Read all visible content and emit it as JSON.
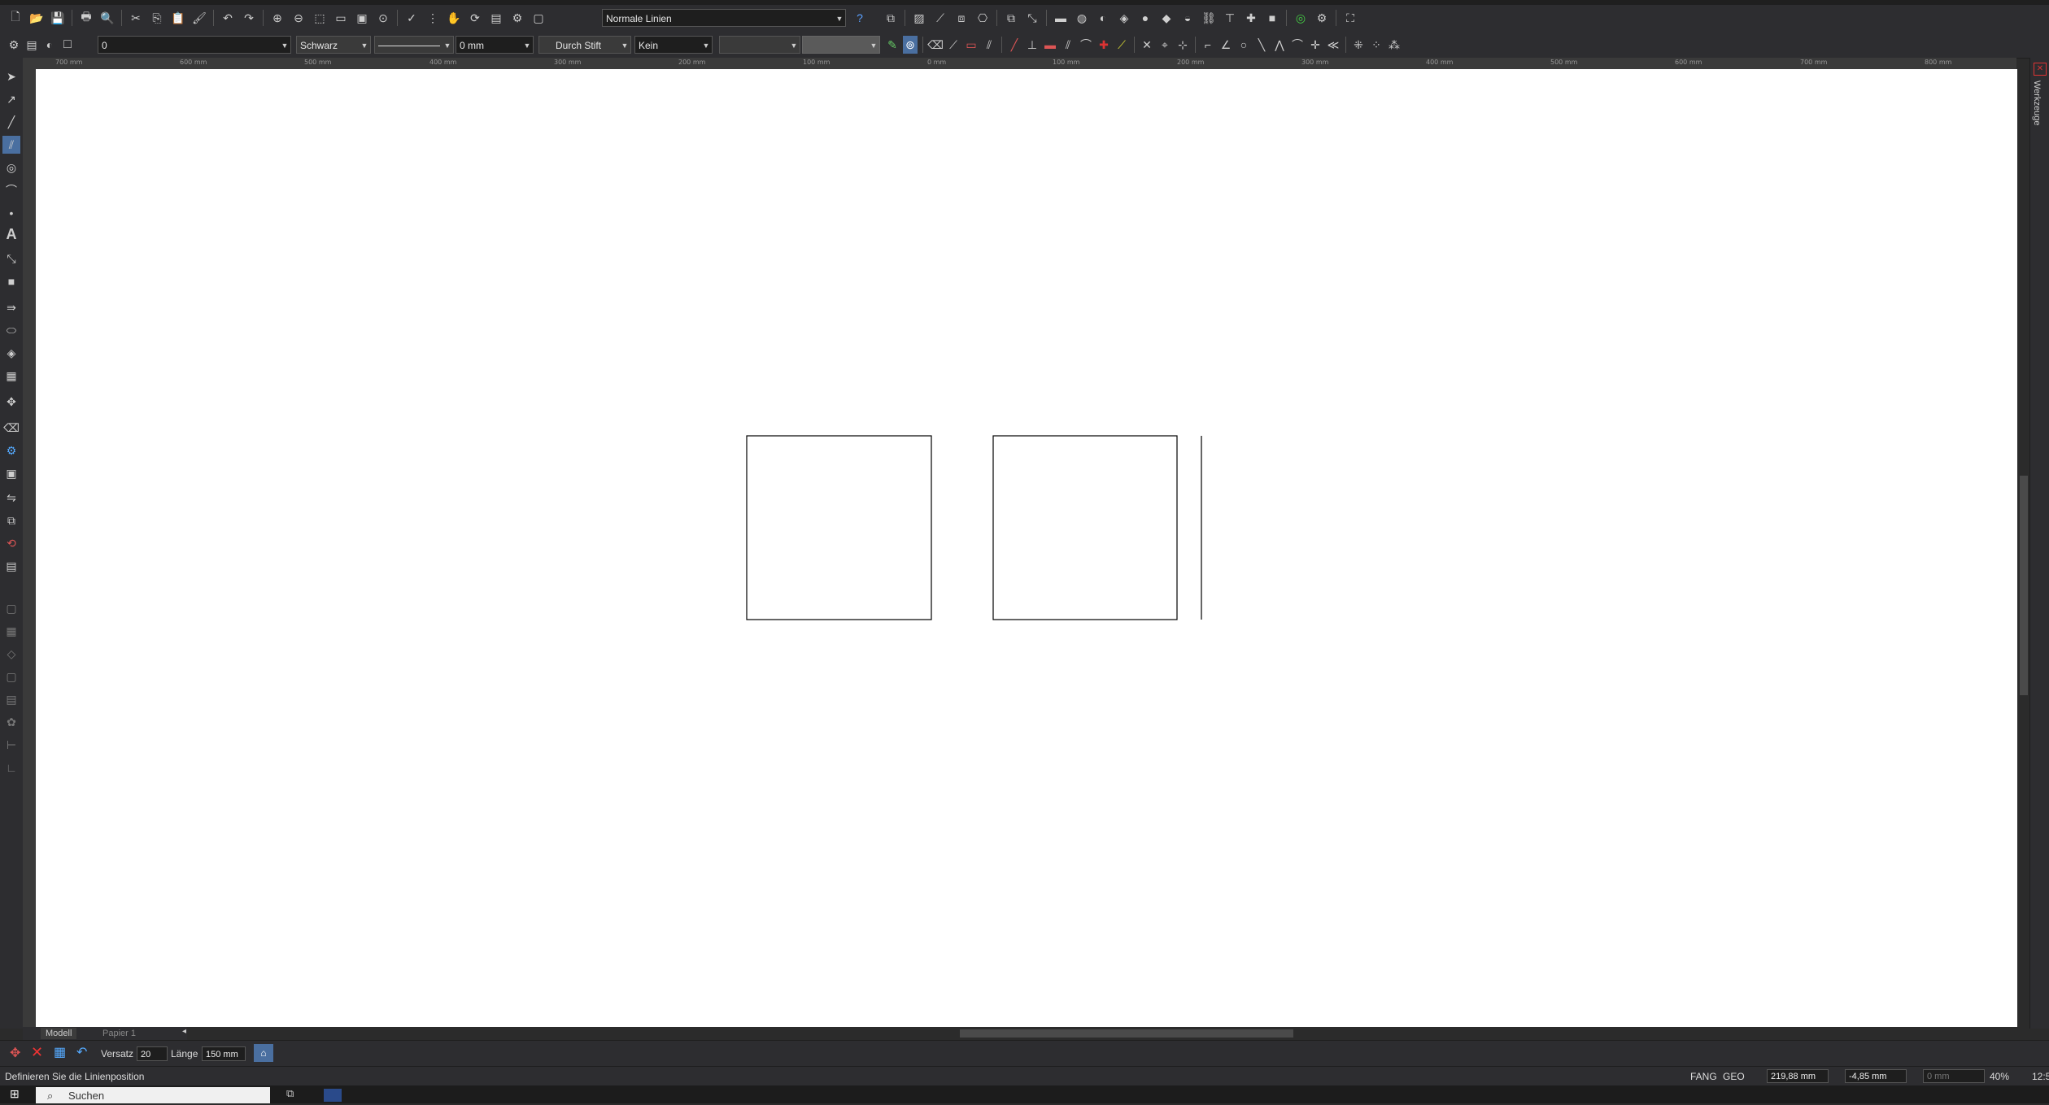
{
  "toolbar1": {
    "line_style_combo": "Normale Linien"
  },
  "toolbar2": {
    "layer_combo": "0",
    "color_combo": "Schwarz",
    "thickness_combo": "0 mm",
    "pen_combo": "Durch Stift",
    "fill_combo": "Kein"
  },
  "ruler": {
    "labels": [
      "700 mm",
      "600 mm",
      "500 mm",
      "400 mm",
      "300 mm",
      "200 mm",
      "100 mm",
      "0 mm",
      "100 mm",
      "200 mm",
      "300 mm",
      "400 mm",
      "500 mm",
      "600 mm",
      "700 mm",
      "800 mm"
    ]
  },
  "right_panel": {
    "label": "Werkzeuge"
  },
  "tabs": {
    "model": "Modell",
    "paper": "Papier 1"
  },
  "command_bar": {
    "offset_label": "Versatz",
    "offset_value": "20",
    "length_label": "Länge",
    "length_value": "150 mm"
  },
  "status": {
    "prompt": "Definieren Sie die Linienposition",
    "snap_mode": "FANG",
    "geo_mode": "GEO",
    "x_coord": "219,88 mm",
    "y_coord": "-4,85 mm",
    "z_coord": "0 mm",
    "zoom": "40%",
    "time": "12:5"
  },
  "taskbar": {
    "search_placeholder": "Suchen"
  },
  "colors": {
    "background": "#2d2d30",
    "canvas": "#ffffff",
    "drawing_line": "#000000"
  }
}
